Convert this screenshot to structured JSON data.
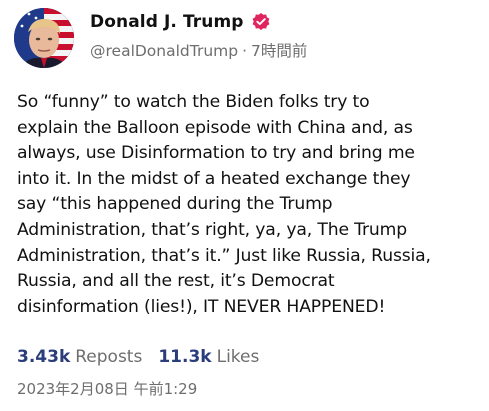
{
  "post": {
    "author": {
      "display_name": "Donald J. Trump",
      "handle": "@realDonaldTrump",
      "separator": "·",
      "relative_time": "7時間前",
      "avatar_icon": "avatar-portrait",
      "verified_icon": "verified-badge-icon",
      "verified_color": "#e0245e"
    },
    "text": "So “funny” to watch the Biden folks try to\nexplain the Balloon episode with China and, as\nalways, use Disinformation to try and bring me\ninto it. In the midst of a heated exchange they\nsay “this happened during the Trump\nAdministration, that’s right, ya, ya, The Trump\nAdministration, that’s it.” Just like Russia, Russia,\nRussia, and all the rest, it’s Democrat\ndisinformation (lies!), IT NEVER HAPPENED!",
    "stats": {
      "reposts_count": "3.43k",
      "reposts_label": "Reposts",
      "likes_count": "11.3k",
      "likes_label": "Likes"
    },
    "timestamp": "2023年2月08日 午前1:29",
    "colors": {
      "text": "#111111",
      "muted": "#6e6e6e",
      "count": "#2a3d7a"
    }
  }
}
